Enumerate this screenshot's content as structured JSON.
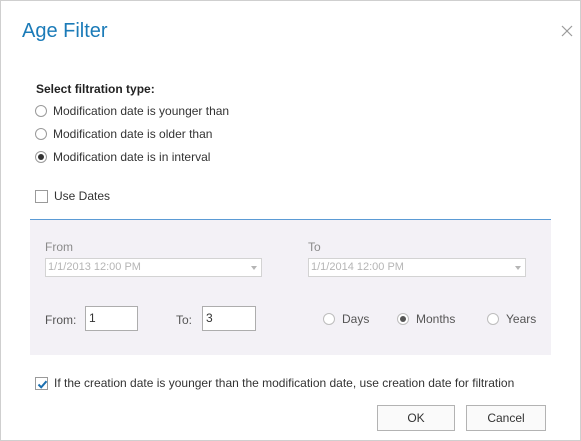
{
  "dialog": {
    "title": "Age Filter",
    "close_icon": "close-icon"
  },
  "filtration": {
    "heading": "Select filtration type:",
    "options": [
      {
        "label": "Modification date is younger than",
        "selected": false
      },
      {
        "label": "Modification date is older than",
        "selected": false
      },
      {
        "label": "Modification date is in interval",
        "selected": true
      }
    ]
  },
  "use_dates": {
    "label": "Use Dates",
    "checked": false
  },
  "interval": {
    "from_date_label": "From",
    "from_date_value": "1/1/2013 12:00 PM",
    "to_date_label": "To",
    "to_date_value": "1/1/2014 12:00 PM",
    "from_num_label": "From:",
    "from_num_value": "1",
    "to_num_label": "To:",
    "to_num_value": "3",
    "units": [
      {
        "label": "Days",
        "selected": false
      },
      {
        "label": "Months",
        "selected": true
      },
      {
        "label": "Years",
        "selected": false
      }
    ]
  },
  "creation_option": {
    "label": "If the creation date is younger than the modification date, use creation date for filtration",
    "checked": true
  },
  "buttons": {
    "ok": "OK",
    "cancel": "Cancel"
  },
  "colors": {
    "title": "#1b7bb8",
    "divider": "#5b9bd5",
    "panel_bg": "#f3f1f6",
    "check": "#1b6fb0"
  }
}
